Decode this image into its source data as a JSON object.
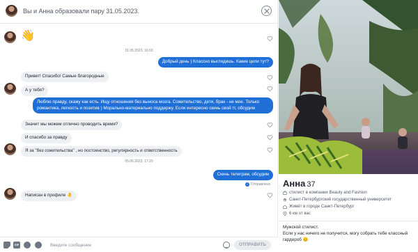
{
  "header": {
    "title": "Вы и Анна образовали пару 31.05.2023."
  },
  "messages": {
    "stamp1": "31.05.2023, 16:03",
    "out1": "Добрый день ) Классно выглядишь. Какие цели тут?",
    "in1": "Привет! Спасибо! Самые благородные",
    "in2": "А у тебя?",
    "out2": "Люблю правду, скажу как есть. Ищу отношения без выноса мозга. Сожительство, дети, брак - не мое. Только романтика, легкость и позитив ) Морально-материально поддержу. Если интересно скинь свой тг, обсудим",
    "in3": "Значит мы можем отлично проводить время?",
    "in4": "И спасибо за правду",
    "in5": "Я за \"без сожительства\" , но постоянство, регулярность  и ответственность",
    "stamp2": "05.06.2023, 17:20",
    "out3": "Скинь телеграм, обсудим",
    "sent_status": "Отправлено",
    "in6": "Написан в профиле 🤚"
  },
  "composer": {
    "gif_label": "GIF",
    "placeholder": "Введите сообщение",
    "send_label": "ОТПРАВИТЬ"
  },
  "profile": {
    "name": "Анна",
    "age": "37",
    "job": "стилист в компании Beauty and Fashion",
    "education": "Санкт-Петербургский государственный университет",
    "city": "Живёт в городе Санкт-Петербург",
    "distance": "6 км от вас",
    "bio_line1": "Мужской стилист.",
    "bio_line2": "Если у нас ничего не получится, могу собрать тебе классный гардероб 😊"
  },
  "colors": {
    "accent": "#1f6fd6",
    "incoming_bubble": "#eef0f4",
    "text": "#21262e"
  }
}
